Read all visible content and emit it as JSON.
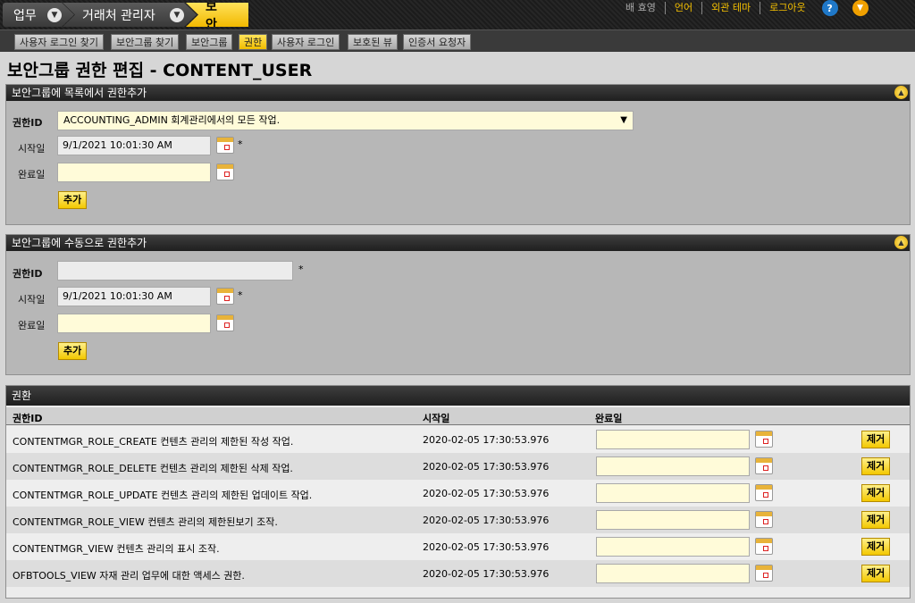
{
  "nav": {
    "crumbs": [
      "업무",
      "거래처 관리자",
      "보안"
    ],
    "util": {
      "user": "배 효영",
      "language": "언어",
      "theme": "외관 테마",
      "logout": "로그아웃",
      "help": "?"
    }
  },
  "subnav": [
    "사용자 로그인 찾기",
    "보안그룹 찾기",
    "보안그룹",
    "권한",
    "사용자 로그인",
    "보호된 뷰",
    "인증서 요청자"
  ],
  "page": {
    "title": "보안그룹 권한 편집 - CONTENT_USER"
  },
  "panel_list": {
    "title": "보안그룹에 목록에서 권한추가",
    "permission_label": "권한ID",
    "permission_selected": "ACCOUNTING_ADMIN 회계관리에서의 모든 작업.",
    "start_label": "시작일",
    "start_value": "9/1/2021 10:01:30 AM",
    "end_label": "완료일",
    "end_value": "",
    "required": "*",
    "add_label": "추가"
  },
  "panel_manual": {
    "title": "보안그룹에 수동으로 권한추가",
    "permission_label": "권한ID",
    "permission_value": "",
    "start_label": "시작일",
    "start_value": "9/1/2021 10:01:30 AM",
    "end_label": "완료일",
    "end_value": "",
    "required": "*",
    "add_label": "추가"
  },
  "permissions": {
    "title": "권환",
    "columns": {
      "id": "권한ID",
      "start": "시작일",
      "end": "완료일"
    },
    "remove_label": "제거",
    "rows": [
      {
        "id": "CONTENTMGR_ROLE_CREATE 컨텐츠 관리의 제한된 작성 작업.",
        "start": "2020-02-05 17:30:53.976",
        "end": ""
      },
      {
        "id": "CONTENTMGR_ROLE_DELETE 컨텐츠 관리의 제한된 삭제 작업.",
        "start": "2020-02-05 17:30:53.976",
        "end": ""
      },
      {
        "id": "CONTENTMGR_ROLE_UPDATE 컨텐츠 관리의 제한된 업데이트 작업.",
        "start": "2020-02-05 17:30:53.976",
        "end": ""
      },
      {
        "id": "CONTENTMGR_ROLE_VIEW 컨텐츠 관리의 제한된보기 조작.",
        "start": "2020-02-05 17:30:53.976",
        "end": ""
      },
      {
        "id": "CONTENTMGR_VIEW 컨텐츠 관리의 표시 조작.",
        "start": "2020-02-05 17:30:53.976",
        "end": ""
      },
      {
        "id": "OFBTOOLS_VIEW 자재 관리 업무에 대한 액세스 권한.",
        "start": "2020-02-05 17:30:53.976",
        "end": ""
      }
    ]
  }
}
